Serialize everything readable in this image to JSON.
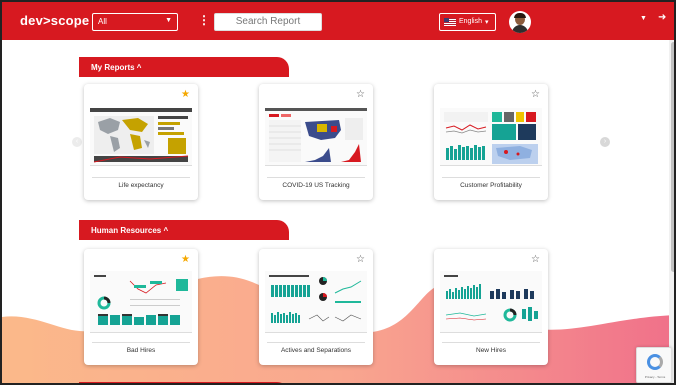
{
  "header": {
    "brand": "dev>scope",
    "filter_select": "All",
    "search_placeholder": "Search Report",
    "language": "English"
  },
  "sections": [
    {
      "title": "My Reports ^",
      "cards": [
        {
          "label": "Life expectancy",
          "starred": true
        },
        {
          "label": "COVID-19 US Tracking",
          "starred": false
        },
        {
          "label": "Customer Profitability",
          "starred": false
        }
      ]
    },
    {
      "title": "Human Resources ^",
      "cards": [
        {
          "label": "Bad Hires",
          "starred": true
        },
        {
          "label": "Actives and Separations",
          "starred": false
        },
        {
          "label": "New Hires",
          "starred": false
        }
      ]
    }
  ],
  "colors": {
    "brand_red": "#d71920",
    "star_active": "#f5a800"
  },
  "recaptcha": {
    "text": "Privacy - Terms"
  }
}
